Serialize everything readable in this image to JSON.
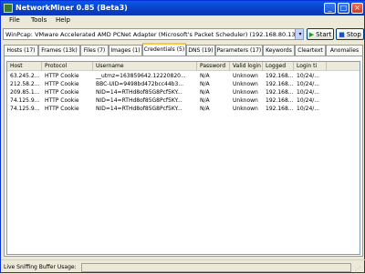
{
  "window": {
    "title": "NetworkMiner 0.85 (Beta3)"
  },
  "titlebar": {
    "minimize": "_",
    "maximize": "□",
    "close": "×"
  },
  "menu": [
    "File",
    "Tools",
    "Help"
  ],
  "toolbar": {
    "adapter_value": "WinPcap: VMware Accelerated AMD PCNet Adapter (Microsoft's Packet Scheduler)  (192.168.80.130) fi",
    "dropdown_glyph": "▾",
    "start_label": "Start",
    "stop_label": "Stop",
    "start_glyph": "▶",
    "stop_glyph": "■",
    "start_color": "#1f9d1f",
    "stop_color": "#1f4fb8"
  },
  "tabs": [
    "Hosts (17)",
    "Frames (13k)",
    "Files (7)",
    "Images (1)",
    "Credentials (5)",
    "DNS (19)",
    "Parameters (17)",
    "Keywords",
    "Cleartext",
    "Anomalies"
  ],
  "active_tab": "Credentials (5)",
  "columns": [
    "Host",
    "Protocol",
    "Username",
    "Password",
    "Valid login",
    "Logged",
    "Login ti"
  ],
  "rows": [
    [
      "63.245.2...",
      "HTTP Cookie",
      "__utmz=163859642.12220820...",
      "N/A",
      "Unknown",
      "192.168....",
      "10/24/..."
    ],
    [
      "212.58.2...",
      "HTTP Cookie",
      "BBC-UID=9498bd472bcc44b3...",
      "N/A",
      "Unknown",
      "192.168....",
      "10/24/..."
    ],
    [
      "209.85.1...",
      "HTTP Cookie",
      "NID=14=RTHd8of85G8Pcf5KY...",
      "N/A",
      "Unknown",
      "192.168....",
      "10/24/..."
    ],
    [
      "74.125.9...",
      "HTTP Cookie",
      "NID=14=RTHd8of85G8Pcf5KY...",
      "N/A",
      "Unknown",
      "192.168....",
      "10/24/..."
    ],
    [
      "74.125.9...",
      "HTTP Cookie",
      "NID=14=RTHd8of85G8Pcf5KY...",
      "N/A",
      "Unknown",
      "192.168....",
      "10/24/..."
    ]
  ],
  "status": {
    "label": "Live Sniffing Buffer Usage:"
  }
}
